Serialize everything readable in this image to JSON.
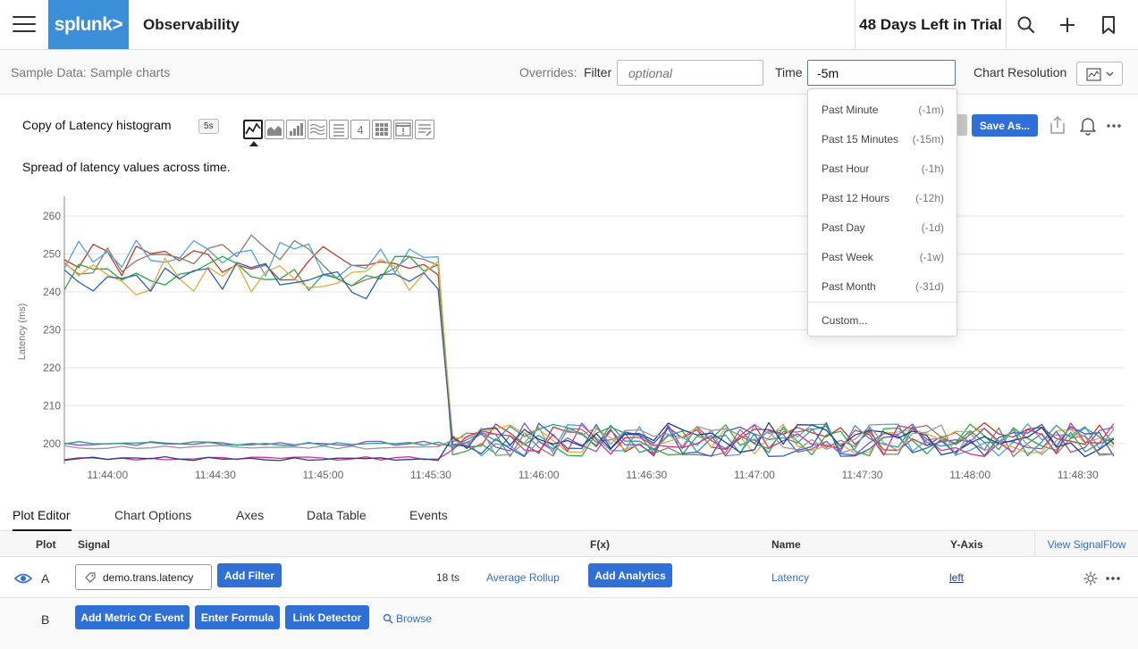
{
  "topbar": {
    "logo": "splunk>",
    "app_title": "Observability",
    "trial_text": "48 Days Left in Trial"
  },
  "overrides": {
    "sample_title": "Sample Data: Sample charts",
    "overrides_label": "Overrides:",
    "filter_label": "Filter",
    "filter_placeholder": "optional",
    "time_label": "Time",
    "time_value": "-5m",
    "resolution_label": "Chart Resolution"
  },
  "chart_header": {
    "name": "Copy of Latency histogram",
    "refresh": "5s",
    "description": "Spread of latency values across time.",
    "save_as": "Save As...",
    "type_number_icon": "4"
  },
  "time_dropdown": {
    "items": [
      {
        "label": "Past Minute",
        "code": "(-1m)"
      },
      {
        "label": "Past 15 Minutes",
        "code": "(-15m)"
      },
      {
        "label": "Past Hour",
        "code": "(-1h)"
      },
      {
        "label": "Past 12 Hours",
        "code": "(-12h)"
      },
      {
        "label": "Past Day",
        "code": "(-1d)"
      },
      {
        "label": "Past Week",
        "code": "(-1w)"
      },
      {
        "label": "Past Month",
        "code": "(-31d)"
      }
    ],
    "custom": "Custom..."
  },
  "chart_data": {
    "type": "line",
    "ylabel": "Latency (ms)",
    "xlabel": "",
    "yticks": [
      200,
      210,
      220,
      230,
      240,
      250,
      260
    ],
    "ylim": [
      195,
      264
    ],
    "xticks": [
      "11:44:00",
      "11:44:30",
      "11:45:00",
      "11:45:30",
      "11:46:00",
      "11:46:30",
      "11:47:00",
      "11:47:30",
      "11:48:00",
      "11:48:30"
    ],
    "xlim": [
      0,
      295
    ],
    "x_unit_note": "x values are seconds after 11:43:48",
    "grid": true,
    "series": [
      {
        "color": "#c0392b",
        "high": true,
        "base": 248,
        "amp": 5,
        "seed": 1
      },
      {
        "color": "#8a7b6a",
        "high": true,
        "base": 249,
        "amp": 6,
        "seed": 2
      },
      {
        "color": "#4fa3e0",
        "high": true,
        "base": 249,
        "amp": 5,
        "seed": 3
      },
      {
        "color": "#2ea84a",
        "high": true,
        "base": 245,
        "amp": 5,
        "seed": 4
      },
      {
        "color": "#e8a93a",
        "high": true,
        "base": 244,
        "amp": 5,
        "seed": 5
      },
      {
        "color": "#2f5fb8",
        "high": true,
        "base": 244,
        "amp": 4,
        "seed": 6
      },
      {
        "color": "#7e57c2",
        "high": false,
        "base": 200,
        "amp": 0.6,
        "seed": 7
      },
      {
        "color": "#2a9d8f",
        "high": false,
        "base": 200,
        "amp": 0.6,
        "seed": 8
      },
      {
        "color": "#d63384",
        "high": false,
        "base": 196,
        "amp": 0.5,
        "seed": 9
      },
      {
        "color": "#1f3f8a",
        "high": false,
        "base": 196,
        "amp": 0.5,
        "seed": 10
      },
      {
        "color": "#999999",
        "high": false,
        "base": 199,
        "amp": 0.5,
        "seed": 11
      }
    ]
  },
  "tabs": [
    "Plot Editor",
    "Chart Options",
    "Axes",
    "Data Table",
    "Events"
  ],
  "table": {
    "headers": {
      "plot": "Plot",
      "signal": "Signal",
      "fx": "F(x)",
      "name": "Name",
      "yaxis": "Y-Axis"
    },
    "view_signalflow": "View SignalFlow",
    "row_a": {
      "letter": "A",
      "signal": "demo.trans.latency",
      "add_filter": "Add Filter",
      "ts_count": "18 ts",
      "rollup": "Average Rollup",
      "add_analytics": "Add Analytics",
      "name": "Latency",
      "yaxis": "left"
    },
    "row_b": {
      "letter": "B",
      "add_metric": "Add Metric Or Event",
      "enter_formula": "Enter Formula",
      "link_detector": "Link Detector",
      "browse": "Browse"
    }
  }
}
